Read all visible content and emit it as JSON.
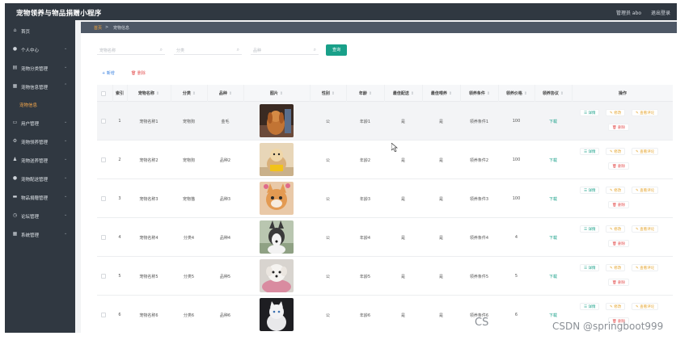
{
  "app": {
    "title": "宠物领养与物品捐赠小程序",
    "user_text": "管理员 abo",
    "logout": "退出登录"
  },
  "sidebar": {
    "items": [
      {
        "label": "首页",
        "icon": "home-icon",
        "glyph": "⌂"
      },
      {
        "label": "个人中心",
        "icon": "user-icon",
        "glyph": "●"
      },
      {
        "label": "宠物分类管理",
        "icon": "category-icon",
        "glyph": "▤"
      },
      {
        "label": "宠物信息管理",
        "icon": "pet-info-icon",
        "glyph": "▦"
      },
      {
        "label": "宠物信息",
        "icon": "",
        "glyph": ""
      },
      {
        "label": "用户管理",
        "icon": "users-icon",
        "glyph": "▭"
      },
      {
        "label": "宠物领养管理",
        "icon": "adopt-icon",
        "glyph": "⚙"
      },
      {
        "label": "宠物送养管理",
        "icon": "give-icon",
        "glyph": "♟"
      },
      {
        "label": "宠物配送管理",
        "icon": "delivery-icon",
        "glyph": "●"
      },
      {
        "label": "物品捐赠管理",
        "icon": "donate-icon",
        "glyph": "▬"
      },
      {
        "label": "论坛管理",
        "icon": "forum-icon",
        "glyph": "◷"
      },
      {
        "label": "系统管理",
        "icon": "system-icon",
        "glyph": "▦"
      }
    ]
  },
  "breadcrumb": {
    "home": "首页",
    "sep": ">",
    "current": "宠物信息"
  },
  "search": {
    "name_placeholder": "宠物名称",
    "category_placeholder": "分类",
    "breed_placeholder": "品种",
    "query_label": "查询"
  },
  "actions": {
    "add": "+ 新增",
    "delete": "🗑 删除"
  },
  "table": {
    "headers": [
      "索引",
      "宠物名称",
      "分类",
      "品种",
      "图片",
      "性别",
      "年龄",
      "最佳配送",
      "最佳喂养",
      "领养条件",
      "领养价格",
      "领养协议",
      "操作"
    ],
    "rows": [
      {
        "index": "1",
        "name": "宠物名称1",
        "category": "宠物狗",
        "breed": "金毛",
        "gender": "公",
        "age": "年龄1",
        "best_delivery": "是",
        "best_feeding": "是",
        "condition": "领养条件1",
        "price": "100",
        "agreement": "下载"
      },
      {
        "index": "2",
        "name": "宠物名称2",
        "category": "宠物狗",
        "breed": "品种2",
        "gender": "公",
        "age": "年龄2",
        "best_delivery": "是",
        "best_feeding": "是",
        "condition": "领养条件2",
        "price": "100",
        "agreement": "下载"
      },
      {
        "index": "3",
        "name": "宠物名称3",
        "category": "宠物猫",
        "breed": "品种3",
        "gender": "公",
        "age": "年龄3",
        "best_delivery": "是",
        "best_feeding": "是",
        "condition": "领养条件3",
        "price": "100",
        "agreement": "下载"
      },
      {
        "index": "4",
        "name": "宠物名称4",
        "category": "分类4",
        "breed": "品种4",
        "gender": "公",
        "age": "年龄4",
        "best_delivery": "是",
        "best_feeding": "是",
        "condition": "领养条件4",
        "price": "4",
        "agreement": "下载"
      },
      {
        "index": "5",
        "name": "宠物名称5",
        "category": "分类5",
        "breed": "品种5",
        "gender": "公",
        "age": "年龄5",
        "best_delivery": "是",
        "best_feeding": "是",
        "condition": "领养条件5",
        "price": "5",
        "agreement": "下载"
      },
      {
        "index": "6",
        "name": "宠物名称6",
        "category": "分类6",
        "breed": "品种6",
        "gender": "公",
        "age": "年龄6",
        "best_delivery": "是",
        "best_feeding": "是",
        "condition": "领养条件6",
        "price": "6",
        "agreement": "下载"
      }
    ],
    "ops": {
      "detail": "详情",
      "edit": "修改",
      "review": "查看评论",
      "delete": "删除"
    }
  },
  "watermark": {
    "left": "CS",
    "right": "CSDN @springboot999"
  },
  "colors": {
    "sidebar_bg": "#303841",
    "accent": "#19a089",
    "warn": "#e4a42d",
    "danger": "#e45757",
    "active_menu": "#f4a64b"
  }
}
